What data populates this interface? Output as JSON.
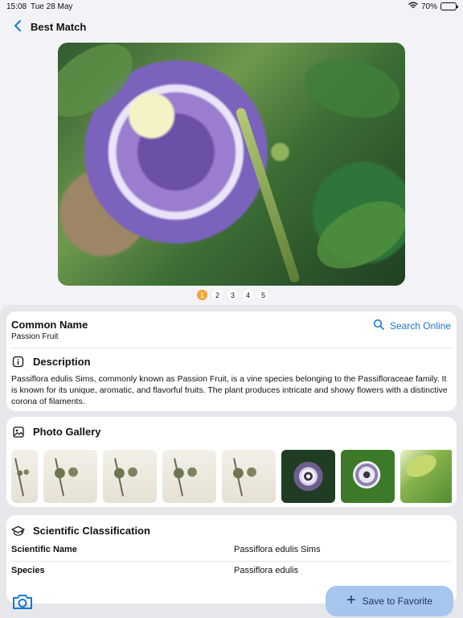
{
  "status": {
    "time": "15:08",
    "date": "Tue 28 May",
    "battery": "70%",
    "battery_level": 0.7
  },
  "nav": {
    "title": "Best Match"
  },
  "pager": [
    "1",
    "2",
    "3",
    "4",
    "5"
  ],
  "common": {
    "label": "Common Name",
    "value": "Passion Fruit",
    "search": "Search Online"
  },
  "description": {
    "title": "Description",
    "text": "Passiflora edulis Sims, commonly known as Passion Fruit, is a vine species belonging to the Passifloraceae family. It is known for its unique, aromatic, and flavorful fruits. The plant produces intricate and showy flowers with a distinctive corona of filaments."
  },
  "gallery": {
    "title": "Photo Gallery"
  },
  "classification": {
    "title": "Scientific Classification",
    "rows": [
      {
        "label": "Scientific Name",
        "value": "Passiflora edulis Sims"
      },
      {
        "label": "Species",
        "value": "Passiflora edulis"
      }
    ]
  },
  "actions": {
    "save": "Save to Favorite"
  },
  "colors": {
    "accent": "#1677d2",
    "pager_active": "#f4a533",
    "favorite_button": "#a6c6ed"
  },
  "icons": {
    "back": "chevron-left-icon",
    "info": "info-icon",
    "gallery": "image-icon",
    "classification": "graduation-cap-icon",
    "search": "search-icon",
    "camera": "camera-icon",
    "plus": "plus-icon"
  }
}
